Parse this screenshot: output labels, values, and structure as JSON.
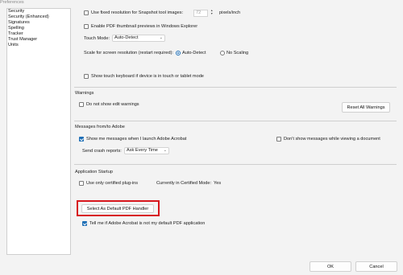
{
  "window": {
    "title": "Preferences"
  },
  "sidebar": {
    "items": [
      {
        "label": "Security"
      },
      {
        "label": "Security (Enhanced)"
      },
      {
        "label": "Signatures"
      },
      {
        "label": "Spelling"
      },
      {
        "label": "Tracker"
      },
      {
        "label": "Trust Manager"
      },
      {
        "label": "Units"
      }
    ]
  },
  "display": {
    "fixed_resolution_label": "Use fixed resolution for Snapshot tool images:",
    "fixed_resolution_checked": false,
    "resolution_value": "72",
    "resolution_unit": "pixels/inch",
    "pdf_thumbnail_label": "Enable PDF thumbnail previews in Windows Explorer",
    "pdf_thumbnail_checked": false,
    "touch_mode_label": "Touch Mode:",
    "touch_mode_value": "Auto-Detect",
    "scale_label": "Scale for screen resolution (restart required):",
    "scale_options": [
      {
        "label": "Auto-Detect",
        "selected": true
      },
      {
        "label": "No Scaling",
        "selected": false
      }
    ],
    "touch_keyboard_label": "Show touch keyboard if device is in touch or tablet mode",
    "touch_keyboard_checked": false
  },
  "warnings": {
    "title": "Warnings",
    "no_edit_warnings_label": "Do not show edit warnings",
    "no_edit_warnings_checked": false,
    "reset_button": "Reset All Warnings"
  },
  "messages": {
    "title": "Messages from/to Adobe",
    "show_messages_label": "Show me messages when I launch Adobe Acrobat",
    "show_messages_checked": true,
    "dont_show_viewing_label": "Don't show messages while viewing a document",
    "dont_show_viewing_checked": false,
    "crash_reports_label": "Send crash reports:",
    "crash_reports_value": "Ask Every Time"
  },
  "startup": {
    "title": "Application Startup",
    "certified_plugins_label": "Use only certified plug-ins",
    "certified_plugins_checked": false,
    "certified_mode_label": "Currently in Certified Mode:",
    "certified_mode_value": "Yes",
    "default_handler_button": "Select As Default PDF Handler",
    "tell_me_label": "Tell me if Adobe Acrobat is not my default PDF application",
    "tell_me_checked": true
  },
  "footer": {
    "ok_button": "OK",
    "cancel_button": "Cancel"
  },
  "colors": {
    "accent": "#1f6fb6",
    "highlight": "#d7161c"
  }
}
